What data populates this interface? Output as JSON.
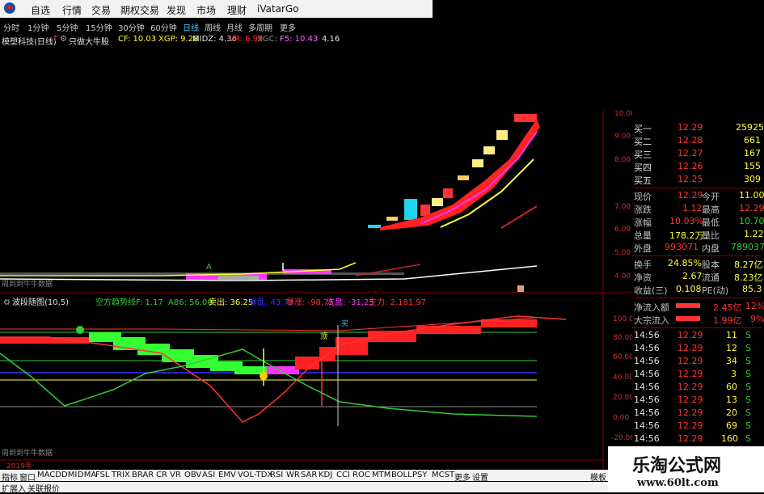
{
  "menu": {
    "items": [
      "自选",
      "行情",
      "交易",
      "期权交易",
      "发现",
      "市场",
      "理财",
      "iVatarGo"
    ]
  },
  "periods": {
    "items": [
      "分时",
      "1分钟",
      "5分钟",
      "15分钟",
      "30分钟",
      "60分钟",
      "日线",
      "周线",
      "月线",
      "多周期",
      "更多"
    ],
    "active": "日线"
  },
  "stock": {
    "name": "模塑科技(日线)",
    "strategy": "只做大牛股",
    "cf": "CF: 10.03",
    "xgp": "XGP: 9.28",
    "midz": "MIDZ: 4.36",
    "vr": "VR: 6.99",
    "xgc": "XGC: -",
    "f5": "F5: 10.43",
    "extra": "4.16"
  },
  "main_chart": {
    "y_ticks": [
      "10.00",
      "9.00",
      "8.00",
      "7.00",
      "6.00",
      "5.00",
      "4.00"
    ],
    "footer_text": "周到到牛牛数据"
  },
  "indicator": {
    "title": "波段随图(10,5)",
    "legend": [
      {
        "text": "空方趋势线F: 1.17",
        "color": "#33cc33"
      },
      {
        "text": "A86: 56.00",
        "color": "#33cc33"
      },
      {
        "text": "卖出: 36.25",
        "color": "#ffff33"
      },
      {
        "text": "暴乱: 43.72",
        "color": "#3333ff"
      },
      {
        "text": "暴涨: -98.75",
        "color": "#ff3333"
      },
      {
        "text": "洗盘: -31.25",
        "color": "#ff33ff"
      },
      {
        "text": "主力: 2.181.97",
        "color": "#ff3333"
      }
    ],
    "y_ticks": [
      "100.00",
      "80.00",
      "60.00",
      "40.00",
      "20.00",
      "0.00",
      "-20.00"
    ],
    "footer_text": "周到到牛牛数据",
    "marker_buy": "买",
    "marker_top": "顶"
  },
  "date_label": "2019年",
  "order_book": [
    {
      "label": "买一",
      "price": "12.29",
      "vol": "25925"
    },
    {
      "label": "买二",
      "price": "12.28",
      "vol": "661"
    },
    {
      "label": "买三",
      "price": "12.27",
      "vol": "167"
    },
    {
      "label": "买四",
      "price": "12.26",
      "vol": "155"
    },
    {
      "label": "买五",
      "price": "12.25",
      "vol": "309"
    }
  ],
  "quote": [
    {
      "l1": "现价",
      "v1": "12.29",
      "l2": "今开",
      "v2": "11.00"
    },
    {
      "l1": "涨跌",
      "v1": "1.12",
      "l2": "最高",
      "v2": "12.29"
    },
    {
      "l1": "涨幅",
      "v1": "10.03%",
      "l2": "最低",
      "v2": "10.70"
    },
    {
      "l1": "总量",
      "v1": "178.2万",
      "l2": "量比",
      "v2": "1.22"
    },
    {
      "l1": "外盘",
      "v1": "993071",
      "l2": "内盘",
      "v2": "789037"
    }
  ],
  "stats": [
    {
      "l1": "换手",
      "v1": "24.85%",
      "l2": "股本",
      "v2": "8.27亿"
    },
    {
      "l1": "净资",
      "v1": "2.67",
      "l2": "流通",
      "v2": "8.23亿"
    },
    {
      "l1": "收益(三)",
      "v1": "0.108",
      "l2": "PE(动)",
      "v2": "85.3"
    }
  ],
  "flows": [
    {
      "label": "净流入额",
      "value": "2.45亿",
      "pct": "12%"
    },
    {
      "label": "大宗流入",
      "value": "1.99亿",
      "pct": "9%"
    }
  ],
  "ticks": [
    {
      "time": "14:56",
      "price": "12.29",
      "vol": "11",
      "dir": "S"
    },
    {
      "time": "14:56",
      "price": "12.29",
      "vol": "12",
      "dir": "S"
    },
    {
      "time": "14:56",
      "price": "12.29",
      "vol": "34",
      "dir": "S"
    },
    {
      "time": "14:56",
      "price": "12.29",
      "vol": "3",
      "dir": "S"
    },
    {
      "time": "14:56",
      "price": "12.29",
      "vol": "60",
      "dir": "S"
    },
    {
      "time": "14:56",
      "price": "12.29",
      "vol": "13",
      "dir": "S"
    },
    {
      "time": "14:56",
      "price": "12.29",
      "vol": "20",
      "dir": "S"
    },
    {
      "time": "14:56",
      "price": "12.29",
      "vol": "69",
      "dir": "S"
    },
    {
      "time": "14:56",
      "price": "12.29",
      "vol": "160",
      "dir": "S"
    }
  ],
  "bottom_tabs": [
    "指标",
    "窗口",
    "MACD",
    "DMI",
    "DMA",
    "FSL",
    "TRIX",
    "BRAR",
    "CR",
    "VR",
    "OBV",
    "ASI",
    "EMV",
    "VOL-TDX",
    "RSI",
    "WR",
    "SAR",
    "KDJ",
    "CCI",
    "ROC",
    "MTM",
    "BOLL",
    "PSY",
    "MCST",
    "更多",
    "设置"
  ],
  "bottom_right_tab": "模板",
  "bottom_line": [
    "扩展入",
    "关联报价"
  ],
  "watermark": {
    "title": "乐淘公式网",
    "url": "www.60lt.com"
  },
  "colors": {
    "up": "#ff3333",
    "down": "#33cc33",
    "accent": "#4fc3ff",
    "yellow": "#ffff33"
  }
}
